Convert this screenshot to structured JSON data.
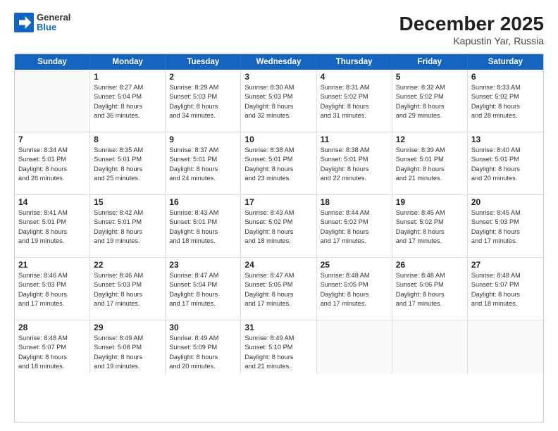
{
  "logo": {
    "general": "General",
    "blue": "Blue"
  },
  "header": {
    "month": "December 2025",
    "location": "Kapustin Yar, Russia"
  },
  "weekdays": [
    "Sunday",
    "Monday",
    "Tuesday",
    "Wednesday",
    "Thursday",
    "Friday",
    "Saturday"
  ],
  "weeks": [
    [
      {
        "day": "",
        "lines": []
      },
      {
        "day": "1",
        "lines": [
          "Sunrise: 8:27 AM",
          "Sunset: 5:04 PM",
          "Daylight: 8 hours",
          "and 36 minutes."
        ]
      },
      {
        "day": "2",
        "lines": [
          "Sunrise: 8:29 AM",
          "Sunset: 5:03 PM",
          "Daylight: 8 hours",
          "and 34 minutes."
        ]
      },
      {
        "day": "3",
        "lines": [
          "Sunrise: 8:30 AM",
          "Sunset: 5:03 PM",
          "Daylight: 8 hours",
          "and 32 minutes."
        ]
      },
      {
        "day": "4",
        "lines": [
          "Sunrise: 8:31 AM",
          "Sunset: 5:02 PM",
          "Daylight: 8 hours",
          "and 31 minutes."
        ]
      },
      {
        "day": "5",
        "lines": [
          "Sunrise: 8:32 AM",
          "Sunset: 5:02 PM",
          "Daylight: 8 hours",
          "and 29 minutes."
        ]
      },
      {
        "day": "6",
        "lines": [
          "Sunrise: 8:33 AM",
          "Sunset: 5:02 PM",
          "Daylight: 8 hours",
          "and 28 minutes."
        ]
      }
    ],
    [
      {
        "day": "7",
        "lines": [
          "Sunrise: 8:34 AM",
          "Sunset: 5:01 PM",
          "Daylight: 8 hours",
          "and 26 minutes."
        ]
      },
      {
        "day": "8",
        "lines": [
          "Sunrise: 8:35 AM",
          "Sunset: 5:01 PM",
          "Daylight: 8 hours",
          "and 25 minutes."
        ]
      },
      {
        "day": "9",
        "lines": [
          "Sunrise: 8:37 AM",
          "Sunset: 5:01 PM",
          "Daylight: 8 hours",
          "and 24 minutes."
        ]
      },
      {
        "day": "10",
        "lines": [
          "Sunrise: 8:38 AM",
          "Sunset: 5:01 PM",
          "Daylight: 8 hours",
          "and 23 minutes."
        ]
      },
      {
        "day": "11",
        "lines": [
          "Sunrise: 8:38 AM",
          "Sunset: 5:01 PM",
          "Daylight: 8 hours",
          "and 22 minutes."
        ]
      },
      {
        "day": "12",
        "lines": [
          "Sunrise: 8:39 AM",
          "Sunset: 5:01 PM",
          "Daylight: 8 hours",
          "and 21 minutes."
        ]
      },
      {
        "day": "13",
        "lines": [
          "Sunrise: 8:40 AM",
          "Sunset: 5:01 PM",
          "Daylight: 8 hours",
          "and 20 minutes."
        ]
      }
    ],
    [
      {
        "day": "14",
        "lines": [
          "Sunrise: 8:41 AM",
          "Sunset: 5:01 PM",
          "Daylight: 8 hours",
          "and 19 minutes."
        ]
      },
      {
        "day": "15",
        "lines": [
          "Sunrise: 8:42 AM",
          "Sunset: 5:01 PM",
          "Daylight: 8 hours",
          "and 19 minutes."
        ]
      },
      {
        "day": "16",
        "lines": [
          "Sunrise: 8:43 AM",
          "Sunset: 5:01 PM",
          "Daylight: 8 hours",
          "and 18 minutes."
        ]
      },
      {
        "day": "17",
        "lines": [
          "Sunrise: 8:43 AM",
          "Sunset: 5:02 PM",
          "Daylight: 8 hours",
          "and 18 minutes."
        ]
      },
      {
        "day": "18",
        "lines": [
          "Sunrise: 8:44 AM",
          "Sunset: 5:02 PM",
          "Daylight: 8 hours",
          "and 17 minutes."
        ]
      },
      {
        "day": "19",
        "lines": [
          "Sunrise: 8:45 AM",
          "Sunset: 5:02 PM",
          "Daylight: 8 hours",
          "and 17 minutes."
        ]
      },
      {
        "day": "20",
        "lines": [
          "Sunrise: 8:45 AM",
          "Sunset: 5:03 PM",
          "Daylight: 8 hours",
          "and 17 minutes."
        ]
      }
    ],
    [
      {
        "day": "21",
        "lines": [
          "Sunrise: 8:46 AM",
          "Sunset: 5:03 PM",
          "Daylight: 8 hours",
          "and 17 minutes."
        ]
      },
      {
        "day": "22",
        "lines": [
          "Sunrise: 8:46 AM",
          "Sunset: 5:03 PM",
          "Daylight: 8 hours",
          "and 17 minutes."
        ]
      },
      {
        "day": "23",
        "lines": [
          "Sunrise: 8:47 AM",
          "Sunset: 5:04 PM",
          "Daylight: 8 hours",
          "and 17 minutes."
        ]
      },
      {
        "day": "24",
        "lines": [
          "Sunrise: 8:47 AM",
          "Sunset: 5:05 PM",
          "Daylight: 8 hours",
          "and 17 minutes."
        ]
      },
      {
        "day": "25",
        "lines": [
          "Sunrise: 8:48 AM",
          "Sunset: 5:05 PM",
          "Daylight: 8 hours",
          "and 17 minutes."
        ]
      },
      {
        "day": "26",
        "lines": [
          "Sunrise: 8:48 AM",
          "Sunset: 5:06 PM",
          "Daylight: 8 hours",
          "and 17 minutes."
        ]
      },
      {
        "day": "27",
        "lines": [
          "Sunrise: 8:48 AM",
          "Sunset: 5:07 PM",
          "Daylight: 8 hours",
          "and 18 minutes."
        ]
      }
    ],
    [
      {
        "day": "28",
        "lines": [
          "Sunrise: 8:48 AM",
          "Sunset: 5:07 PM",
          "Daylight: 8 hours",
          "and 18 minutes."
        ]
      },
      {
        "day": "29",
        "lines": [
          "Sunrise: 8:49 AM",
          "Sunset: 5:08 PM",
          "Daylight: 8 hours",
          "and 19 minutes."
        ]
      },
      {
        "day": "30",
        "lines": [
          "Sunrise: 8:49 AM",
          "Sunset: 5:09 PM",
          "Daylight: 8 hours",
          "and 20 minutes."
        ]
      },
      {
        "day": "31",
        "lines": [
          "Sunrise: 8:49 AM",
          "Sunset: 5:10 PM",
          "Daylight: 8 hours",
          "and 21 minutes."
        ]
      },
      {
        "day": "",
        "lines": []
      },
      {
        "day": "",
        "lines": []
      },
      {
        "day": "",
        "lines": []
      }
    ]
  ]
}
